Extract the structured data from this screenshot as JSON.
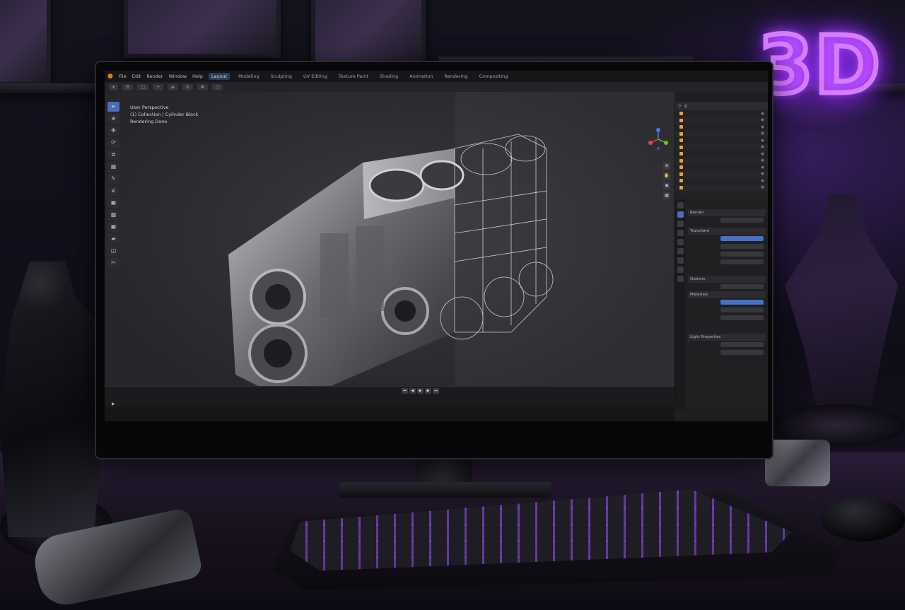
{
  "app": {
    "menu": [
      "File",
      "Edit",
      "Render",
      "Window",
      "Help"
    ],
    "workspaces": [
      "Layout",
      "Modeling",
      "Sculpting",
      "UV Editing",
      "Texture Paint",
      "Shading",
      "Animation",
      "Rendering",
      "Compositing"
    ],
    "active_workspace": "Layout"
  },
  "viewport": {
    "view_name": "User Perspective",
    "collection_path": "(1) Collection | Cylinder Block",
    "status": "Rendering Done"
  },
  "properties": {
    "sections": [
      "Render",
      "Transform",
      "Options",
      "Materials",
      "Light Properties"
    ]
  },
  "wall_sign": {
    "text": "3D"
  },
  "colors": {
    "accent_blue": "#4a6db5",
    "neon_purple": "#b44cff",
    "blender_orange": "#e87d0d"
  },
  "icons": [
    "blender-logo-icon",
    "cursor-icon",
    "move-icon",
    "rotate-icon",
    "scale-icon",
    "annotate-icon",
    "measure-icon"
  ]
}
